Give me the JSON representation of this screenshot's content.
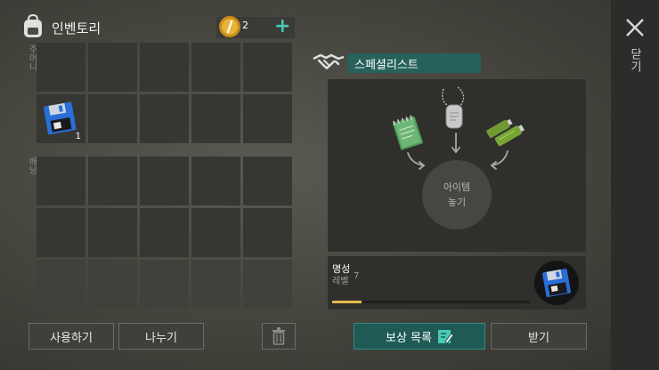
{
  "inventory": {
    "title": "인벤토리",
    "coins": "2",
    "add_label": "+",
    "pocket_label": "주머니",
    "bag_label": "배낭",
    "pocket_item": {
      "name": "floppy-disk-icon",
      "qty": "1"
    },
    "use_label": "사용하기",
    "split_label": "나누기"
  },
  "specialist": {
    "title": "스페셜리스트",
    "slot_line1": "아이템",
    "slot_line2": "놓기",
    "ingredients": [
      "notebook-icon",
      "dog-tag-icon",
      "battery-icon"
    ],
    "reputation_title": "명성",
    "level_label": "레벨",
    "level_value": "7",
    "reputation_progress": 0.15,
    "reward_label": "보상 목록",
    "claim_label": "받기"
  },
  "close": {
    "label": "닫기"
  },
  "colors": {
    "accent": "#4cc9b8",
    "teal_dark": "#1f5a54",
    "progress": "#e6b84a"
  }
}
